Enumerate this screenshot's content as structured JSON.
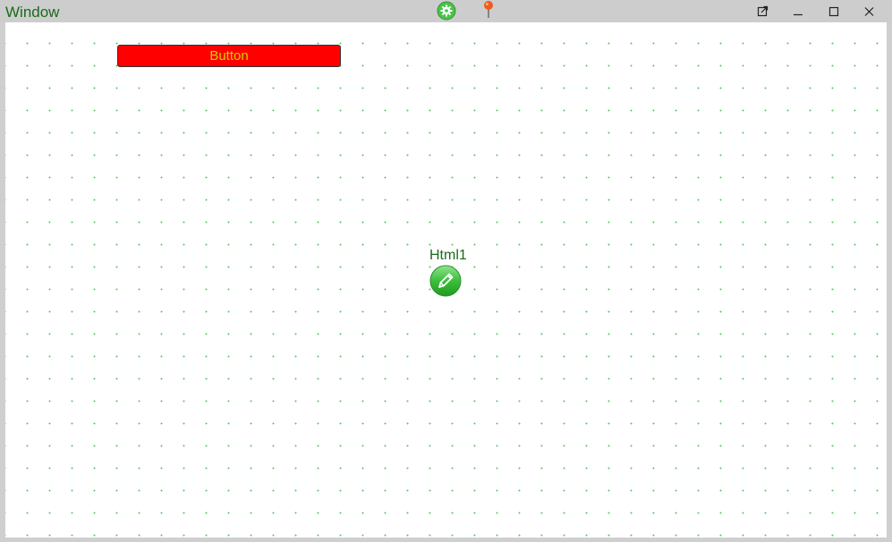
{
  "window": {
    "title": "Window"
  },
  "titlebar": {
    "icons": [
      "gear-icon",
      "pin-icon"
    ],
    "controls": [
      "popout-icon",
      "minimize-icon",
      "maximize-icon",
      "close-icon"
    ]
  },
  "canvas": {
    "button": {
      "label": "Button",
      "background": "#ff0000",
      "text_color": "#c8d400"
    },
    "html_widget": {
      "label": "Html1",
      "icon": "pencil-icon"
    },
    "grid_dot_color": "#5fc95f"
  },
  "colors": {
    "title_text": "#1a6b1a",
    "titlebar_bg": "#cdcdcd",
    "canvas_bg": "#ffffff"
  }
}
